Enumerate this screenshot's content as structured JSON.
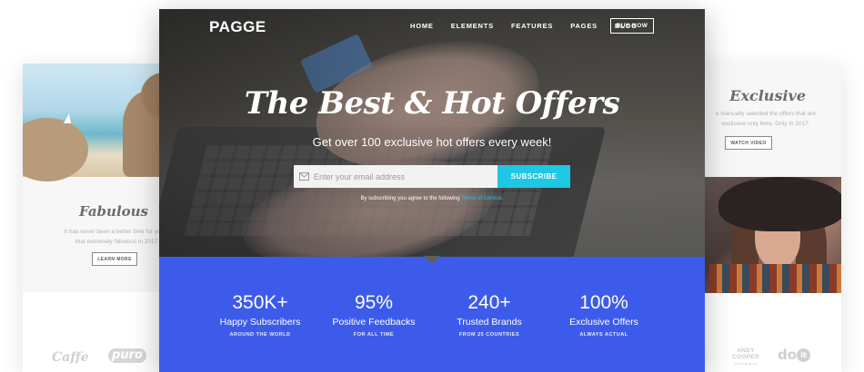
{
  "brand": "PAGGE",
  "nav": {
    "items": [
      "HOME",
      "ELEMENTS",
      "FEATURES",
      "PAGES",
      "BLOG"
    ],
    "cta": "BUY NOW"
  },
  "hero": {
    "title": "The Best & Hot Offers",
    "subtitle": "Get over 100 exclusive hot offers every week!",
    "email_placeholder": "Enter your email address",
    "subscribe_label": "SUBSCRIBE",
    "terms_prefix": "By subscribing you agree to the following",
    "terms_link": "Terms of Service."
  },
  "stats": [
    {
      "value": "350K+",
      "label": "Happy Subscribers",
      "caption": "AROUND THE WORLD"
    },
    {
      "value": "95%",
      "label": "Positive Feedbacks",
      "caption": "FOR ALL TIME"
    },
    {
      "value": "240+",
      "label": "Trusted Brands",
      "caption": "FROM 25 COUNTRIES"
    },
    {
      "value": "100%",
      "label": "Exclusive Offers",
      "caption": "ALWAYS ACTUAL"
    }
  ],
  "left_card": {
    "title": "Fabulous",
    "text_line1": "It has never been a better time for you to",
    "text_line2": "that extremely fabulous in 2017.",
    "button": "LEARN MORE",
    "logo1": "Caffe",
    "logo2": "puro"
  },
  "right_card": {
    "title": "Exclusive",
    "text_line1": "e manually selected the offers that are",
    "text_line2": "exclusive only here. Only in 2017.",
    "button": "WATCH VIDEO",
    "logo1_line1": "ANDY",
    "logo1_line2": "COOPER",
    "logo1_line3": "photography",
    "logo2_text": "do",
    "logo2_badge": "it"
  },
  "colors": {
    "accent_cyan": "#1ec8e4",
    "stats_blue": "#3d5bea"
  }
}
